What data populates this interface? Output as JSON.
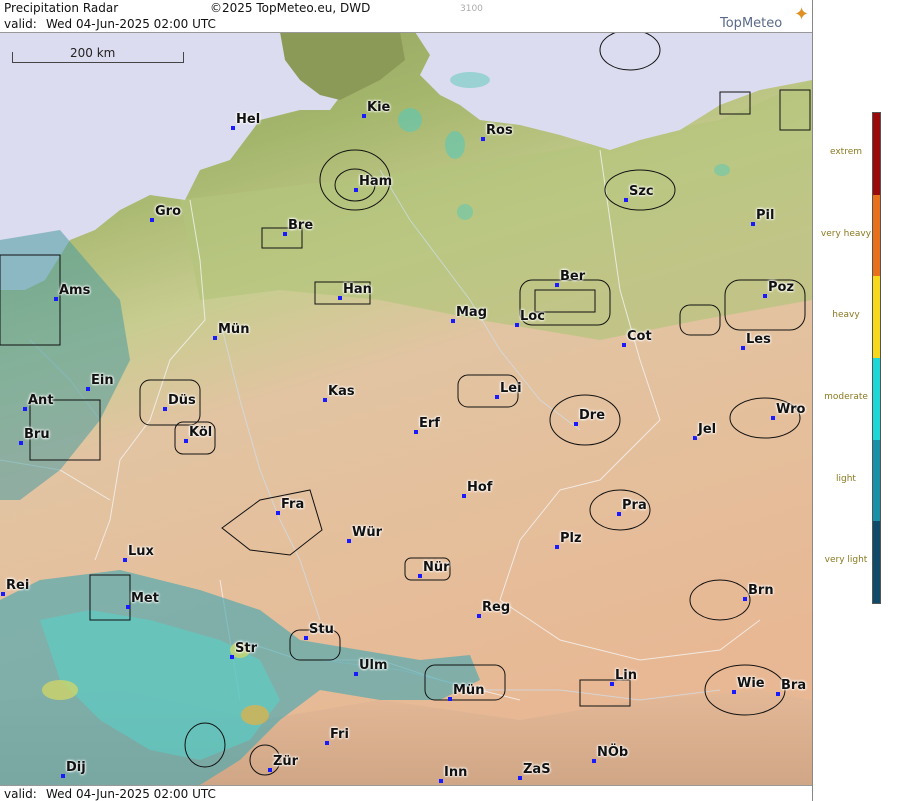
{
  "header": {
    "title": "Precipitation Radar",
    "copyright": "©2025 TopMeteo.eu, DWD",
    "zoom_code": "3100",
    "valid_label": "valid:",
    "valid_text": "Wed 04-Jun-2025 02:00 UTC"
  },
  "footer": {
    "valid_label": "valid:",
    "valid_text": "Wed 04-Jun-2025 02:00 UTC"
  },
  "logo": {
    "text": "TopMeteo",
    "icon": "compass-star-icon"
  },
  "scale": {
    "label": "200 km"
  },
  "cities": [
    {
      "name": "Hel"
    },
    {
      "name": "Kie"
    },
    {
      "name": "Ros"
    },
    {
      "name": "Ham"
    },
    {
      "name": "Szc"
    },
    {
      "name": "Gro"
    },
    {
      "name": "Bre"
    },
    {
      "name": "Pil"
    },
    {
      "name": "Ams"
    },
    {
      "name": "Han"
    },
    {
      "name": "Ber"
    },
    {
      "name": "Poz"
    },
    {
      "name": "Mün"
    },
    {
      "name": "Mag"
    },
    {
      "name": "Loc"
    },
    {
      "name": "Cot"
    },
    {
      "name": "Les"
    },
    {
      "name": "Ein"
    },
    {
      "name": "Kas"
    },
    {
      "name": "Lei"
    },
    {
      "name": "Ant"
    },
    {
      "name": "Düs"
    },
    {
      "name": "Dre"
    },
    {
      "name": "Wro"
    },
    {
      "name": "Bru"
    },
    {
      "name": "Köl"
    },
    {
      "name": "Erf"
    },
    {
      "name": "Jel"
    },
    {
      "name": "Hof"
    },
    {
      "name": "Fra"
    },
    {
      "name": "Pra"
    },
    {
      "name": "Lux"
    },
    {
      "name": "Wür"
    },
    {
      "name": "Plz"
    },
    {
      "name": "Nür"
    },
    {
      "name": "Rei"
    },
    {
      "name": "Met"
    },
    {
      "name": "Brn"
    },
    {
      "name": "Reg"
    },
    {
      "name": "Stu"
    },
    {
      "name": "Str"
    },
    {
      "name": "Ulm"
    },
    {
      "name": "Lin"
    },
    {
      "name": "Mün"
    },
    {
      "name": "Wie"
    },
    {
      "name": "Bra"
    },
    {
      "name": "Fri"
    },
    {
      "name": "NÖb"
    },
    {
      "name": "Dij"
    },
    {
      "name": "Zür"
    },
    {
      "name": "Inn"
    },
    {
      "name": "ZaS"
    }
  ],
  "legend": {
    "levels": [
      {
        "label": "extrem",
        "color": "#9a0a0a"
      },
      {
        "label": "very heavy",
        "color": "#e8701a"
      },
      {
        "label": "heavy",
        "color": "#f8d81a"
      },
      {
        "label": "moderate",
        "color": "#1ed8d8"
      },
      {
        "label": "light",
        "color": "#1890a8"
      },
      {
        "label": "very light",
        "color": "#104a68"
      }
    ]
  },
  "colors": {
    "sea": "#dcdcf0",
    "lowland": "#9aa868",
    "highland": "#e2b898",
    "radar_light": "#4aa8b0",
    "radar_moderate": "#58d0c8",
    "radar_heavy": "#d8d860"
  }
}
